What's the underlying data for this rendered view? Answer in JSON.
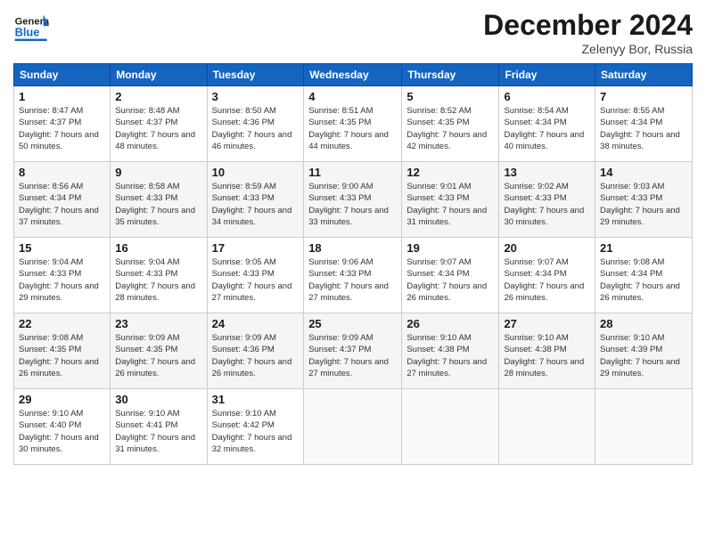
{
  "header": {
    "logo": {
      "general": "General",
      "blue": "Blue"
    },
    "title": "December 2024",
    "location": "Zelenyy Bor, Russia"
  },
  "weekdays": [
    "Sunday",
    "Monday",
    "Tuesday",
    "Wednesday",
    "Thursday",
    "Friday",
    "Saturday"
  ],
  "weeks": [
    [
      {
        "day": "1",
        "sunrise": "Sunrise: 8:47 AM",
        "sunset": "Sunset: 4:37 PM",
        "daylight": "Daylight: 7 hours and 50 minutes."
      },
      {
        "day": "2",
        "sunrise": "Sunrise: 8:48 AM",
        "sunset": "Sunset: 4:37 PM",
        "daylight": "Daylight: 7 hours and 48 minutes."
      },
      {
        "day": "3",
        "sunrise": "Sunrise: 8:50 AM",
        "sunset": "Sunset: 4:36 PM",
        "daylight": "Daylight: 7 hours and 46 minutes."
      },
      {
        "day": "4",
        "sunrise": "Sunrise: 8:51 AM",
        "sunset": "Sunset: 4:35 PM",
        "daylight": "Daylight: 7 hours and 44 minutes."
      },
      {
        "day": "5",
        "sunrise": "Sunrise: 8:52 AM",
        "sunset": "Sunset: 4:35 PM",
        "daylight": "Daylight: 7 hours and 42 minutes."
      },
      {
        "day": "6",
        "sunrise": "Sunrise: 8:54 AM",
        "sunset": "Sunset: 4:34 PM",
        "daylight": "Daylight: 7 hours and 40 minutes."
      },
      {
        "day": "7",
        "sunrise": "Sunrise: 8:55 AM",
        "sunset": "Sunset: 4:34 PM",
        "daylight": "Daylight: 7 hours and 38 minutes."
      }
    ],
    [
      {
        "day": "8",
        "sunrise": "Sunrise: 8:56 AM",
        "sunset": "Sunset: 4:34 PM",
        "daylight": "Daylight: 7 hours and 37 minutes."
      },
      {
        "day": "9",
        "sunrise": "Sunrise: 8:58 AM",
        "sunset": "Sunset: 4:33 PM",
        "daylight": "Daylight: 7 hours and 35 minutes."
      },
      {
        "day": "10",
        "sunrise": "Sunrise: 8:59 AM",
        "sunset": "Sunset: 4:33 PM",
        "daylight": "Daylight: 7 hours and 34 minutes."
      },
      {
        "day": "11",
        "sunrise": "Sunrise: 9:00 AM",
        "sunset": "Sunset: 4:33 PM",
        "daylight": "Daylight: 7 hours and 33 minutes."
      },
      {
        "day": "12",
        "sunrise": "Sunrise: 9:01 AM",
        "sunset": "Sunset: 4:33 PM",
        "daylight": "Daylight: 7 hours and 31 minutes."
      },
      {
        "day": "13",
        "sunrise": "Sunrise: 9:02 AM",
        "sunset": "Sunset: 4:33 PM",
        "daylight": "Daylight: 7 hours and 30 minutes."
      },
      {
        "day": "14",
        "sunrise": "Sunrise: 9:03 AM",
        "sunset": "Sunset: 4:33 PM",
        "daylight": "Daylight: 7 hours and 29 minutes."
      }
    ],
    [
      {
        "day": "15",
        "sunrise": "Sunrise: 9:04 AM",
        "sunset": "Sunset: 4:33 PM",
        "daylight": "Daylight: 7 hours and 29 minutes."
      },
      {
        "day": "16",
        "sunrise": "Sunrise: 9:04 AM",
        "sunset": "Sunset: 4:33 PM",
        "daylight": "Daylight: 7 hours and 28 minutes."
      },
      {
        "day": "17",
        "sunrise": "Sunrise: 9:05 AM",
        "sunset": "Sunset: 4:33 PM",
        "daylight": "Daylight: 7 hours and 27 minutes."
      },
      {
        "day": "18",
        "sunrise": "Sunrise: 9:06 AM",
        "sunset": "Sunset: 4:33 PM",
        "daylight": "Daylight: 7 hours and 27 minutes."
      },
      {
        "day": "19",
        "sunrise": "Sunrise: 9:07 AM",
        "sunset": "Sunset: 4:34 PM",
        "daylight": "Daylight: 7 hours and 26 minutes."
      },
      {
        "day": "20",
        "sunrise": "Sunrise: 9:07 AM",
        "sunset": "Sunset: 4:34 PM",
        "daylight": "Daylight: 7 hours and 26 minutes."
      },
      {
        "day": "21",
        "sunrise": "Sunrise: 9:08 AM",
        "sunset": "Sunset: 4:34 PM",
        "daylight": "Daylight: 7 hours and 26 minutes."
      }
    ],
    [
      {
        "day": "22",
        "sunrise": "Sunrise: 9:08 AM",
        "sunset": "Sunset: 4:35 PM",
        "daylight": "Daylight: 7 hours and 26 minutes."
      },
      {
        "day": "23",
        "sunrise": "Sunrise: 9:09 AM",
        "sunset": "Sunset: 4:35 PM",
        "daylight": "Daylight: 7 hours and 26 minutes."
      },
      {
        "day": "24",
        "sunrise": "Sunrise: 9:09 AM",
        "sunset": "Sunset: 4:36 PM",
        "daylight": "Daylight: 7 hours and 26 minutes."
      },
      {
        "day": "25",
        "sunrise": "Sunrise: 9:09 AM",
        "sunset": "Sunset: 4:37 PM",
        "daylight": "Daylight: 7 hours and 27 minutes."
      },
      {
        "day": "26",
        "sunrise": "Sunrise: 9:10 AM",
        "sunset": "Sunset: 4:38 PM",
        "daylight": "Daylight: 7 hours and 27 minutes."
      },
      {
        "day": "27",
        "sunrise": "Sunrise: 9:10 AM",
        "sunset": "Sunset: 4:38 PM",
        "daylight": "Daylight: 7 hours and 28 minutes."
      },
      {
        "day": "28",
        "sunrise": "Sunrise: 9:10 AM",
        "sunset": "Sunset: 4:39 PM",
        "daylight": "Daylight: 7 hours and 29 minutes."
      }
    ],
    [
      {
        "day": "29",
        "sunrise": "Sunrise: 9:10 AM",
        "sunset": "Sunset: 4:40 PM",
        "daylight": "Daylight: 7 hours and 30 minutes."
      },
      {
        "day": "30",
        "sunrise": "Sunrise: 9:10 AM",
        "sunset": "Sunset: 4:41 PM",
        "daylight": "Daylight: 7 hours and 31 minutes."
      },
      {
        "day": "31",
        "sunrise": "Sunrise: 9:10 AM",
        "sunset": "Sunset: 4:42 PM",
        "daylight": "Daylight: 7 hours and 32 minutes."
      },
      null,
      null,
      null,
      null
    ]
  ]
}
